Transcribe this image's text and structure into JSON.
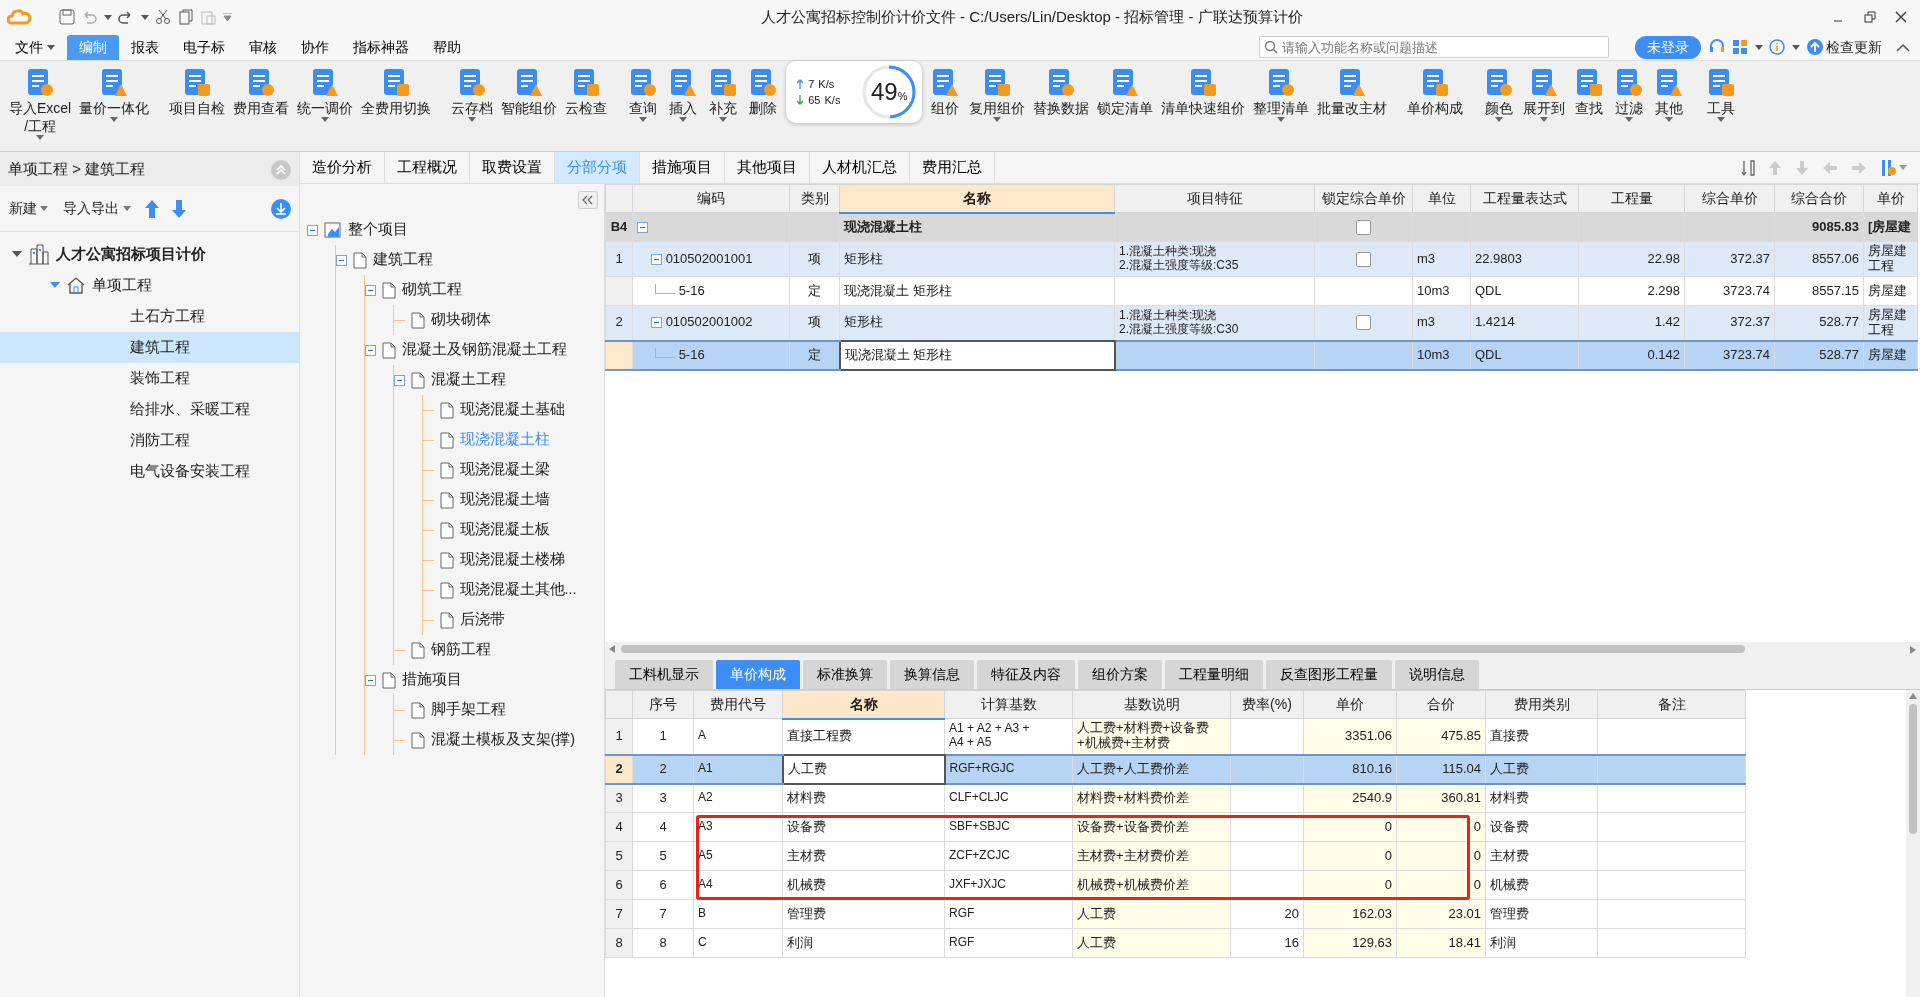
{
  "title_bar": {
    "title": "人才公寓招标控制价计价文件 - C:/Users/Lin/Desktop - 招标管理 - 广联达预算计价"
  },
  "menu": [
    {
      "label": "文件",
      "dropdown": true,
      "selected": false
    },
    {
      "label": "编制",
      "dropdown": false,
      "selected": true
    },
    {
      "label": "报表",
      "dropdown": false,
      "selected": false
    },
    {
      "label": "电子标",
      "dropdown": false,
      "selected": false
    },
    {
      "label": "审核",
      "dropdown": false,
      "selected": false
    },
    {
      "label": "协作",
      "dropdown": false,
      "selected": false
    },
    {
      "label": "指标神器",
      "dropdown": false,
      "selected": false
    },
    {
      "label": "帮助",
      "dropdown": false,
      "selected": false
    }
  ],
  "search": {
    "placeholder": "请输入功能名称或问题描述"
  },
  "login_button": "未登录",
  "update_button": "检查更新",
  "ribbon": {
    "groups": [
      [
        {
          "label": "导入Excel\n/工程",
          "dropdown": true
        },
        {
          "label": "量价一体化",
          "dropdown": true
        }
      ],
      [
        {
          "label": "项目自检",
          "dropdown": false
        },
        {
          "label": "费用查看",
          "dropdown": false
        },
        {
          "label": "统一调价",
          "dropdown": true
        },
        {
          "label": "全费用切换",
          "dropdown": false
        }
      ],
      [
        {
          "label": "云存档",
          "dropdown": true
        },
        {
          "label": "智能组价",
          "dropdown": false
        },
        {
          "label": "云检查",
          "dropdown": false
        }
      ],
      [
        {
          "label": "查询",
          "dropdown": true
        },
        {
          "label": "插入",
          "dropdown": true
        },
        {
          "label": "补充",
          "dropdown": true
        },
        {
          "label": "删除",
          "dropdown": false
        },
        {
          "kind": "widget"
        },
        {
          "label": "组价",
          "dropdown": false
        },
        {
          "label": "复用组价",
          "dropdown": true
        },
        {
          "label": "替换数据",
          "dropdown": false
        },
        {
          "label": "锁定清单",
          "dropdown": false
        },
        {
          "label": "清单快速组价",
          "dropdown": false
        },
        {
          "label": "整理清单",
          "dropdown": true
        },
        {
          "label": "批量改主材",
          "dropdown": false
        }
      ],
      [
        {
          "label": "单价构成",
          "dropdown": false
        }
      ],
      [
        {
          "label": "颜色",
          "dropdown": true
        },
        {
          "label": "展开到",
          "dropdown": true
        },
        {
          "label": "查找",
          "dropdown": false
        },
        {
          "label": "过滤",
          "dropdown": true
        },
        {
          "label": "其他",
          "dropdown": true
        }
      ],
      [
        {
          "label": "工具",
          "dropdown": true
        }
      ]
    ]
  },
  "speed_widget": {
    "upload": "7",
    "upload_unit": "K/s",
    "download": "65",
    "download_unit": "K/s",
    "percent": "49",
    "percent_sign": "%",
    "level": 0.49
  },
  "project_panel": {
    "breadcrumb": "单项工程 > 建筑工程",
    "toolbar": [
      {
        "label": "新建",
        "dropdown": true
      },
      {
        "label": "导入导出",
        "dropdown": true
      }
    ],
    "tree": [
      {
        "label": "人才公寓招标项目计价",
        "expanded": true,
        "selected": false,
        "children": [
          {
            "label": "单项工程",
            "expanded": true,
            "selected": false,
            "children": [
              {
                "label": "土石方工程",
                "selected": false
              },
              {
                "label": "建筑工程",
                "selected": true
              },
              {
                "label": "装饰工程",
                "selected": false
              },
              {
                "label": "给排水、采暖工程",
                "selected": false
              },
              {
                "label": "消防工程",
                "selected": false
              },
              {
                "label": "电气设备安装工程",
                "selected": false
              }
            ]
          }
        ]
      }
    ]
  },
  "view_tabs": [
    {
      "label": "造价分析",
      "selected": false
    },
    {
      "label": "工程概况",
      "selected": false
    },
    {
      "label": "取费设置",
      "selected": false
    },
    {
      "label": "分部分项",
      "selected": true
    },
    {
      "label": "措施项目",
      "selected": false
    },
    {
      "label": "其他项目",
      "selected": false
    },
    {
      "label": "人材机汇总",
      "selected": false
    },
    {
      "label": "费用汇总",
      "selected": false
    }
  ],
  "section_tree": [
    {
      "label": "整个项目",
      "expanded": true,
      "selected": false,
      "children": [
        {
          "label": "建筑工程",
          "expanded": true,
          "selected": false,
          "children": [
            {
              "label": "砌筑工程",
              "expanded": true,
              "selected": false,
              "children": [
                {
                  "label": "砌块砌体",
                  "selected": false
                }
              ]
            },
            {
              "label": "混凝土及钢筋混凝土工程",
              "expanded": true,
              "selected": false,
              "children": [
                {
                  "label": "混凝土工程",
                  "expanded": true,
                  "selected": false,
                  "children": [
                    {
                      "label": "现浇混凝土基础",
                      "selected": false
                    },
                    {
                      "label": "现浇混凝土柱",
                      "selected": true
                    },
                    {
                      "label": "现浇混凝土梁",
                      "selected": false
                    },
                    {
                      "label": "现浇混凝土墙",
                      "selected": false
                    },
                    {
                      "label": "现浇混凝土板",
                      "selected": false
                    },
                    {
                      "label": "现浇混凝土楼梯",
                      "selected": false
                    },
                    {
                      "label": "现浇混凝土其他...",
                      "selected": false
                    },
                    {
                      "label": "后浇带",
                      "selected": false
                    }
                  ]
                },
                {
                  "label": "钢筋工程",
                  "selected": false
                }
              ]
            },
            {
              "label": "措施项目",
              "expanded": true,
              "selected": false,
              "children": [
                {
                  "label": "脚手架工程",
                  "selected": false
                },
                {
                  "label": "混凝土模板及支架(撑)",
                  "selected": false
                }
              ]
            }
          ]
        }
      ]
    }
  ],
  "item_table": {
    "columns": [
      {
        "label": "编码",
        "active": false
      },
      {
        "label": "类别",
        "active": false
      },
      {
        "label": "名称",
        "active": true
      },
      {
        "label": "项目特征",
        "active": false
      },
      {
        "label": "锁定综合单价",
        "active": false
      },
      {
        "label": "单位",
        "active": false
      },
      {
        "label": "工程量表达式",
        "active": false
      },
      {
        "label": "工程量",
        "active": false
      },
      {
        "label": "综合单价",
        "active": false
      },
      {
        "label": "综合合价",
        "active": false
      },
      {
        "label": "单价",
        "active": false
      }
    ],
    "rows": [
      {
        "kind": "section",
        "number": "B4",
        "expanded": true,
        "selected": false,
        "name": "现浇混凝土柱",
        "locked": false,
        "total": "9085.83",
        "column_12": "[房屋建"
      },
      {
        "kind": "item",
        "number": "1",
        "expanded": true,
        "selected": false,
        "code": "010502001001",
        "category": "项",
        "name": "矩形柱",
        "features": "1.混凝土种类:现浇\n2.混凝土强度等级:C35",
        "locked": false,
        "unit": "m3",
        "expression": "22.9803",
        "quantity": "22.98",
        "unit_price": "372.37",
        "total": "8557.06",
        "column_12": "房屋建工程"
      },
      {
        "kind": "quota",
        "selected": false,
        "code": "5-16",
        "category": "定",
        "name": "现浇混凝土 矩形柱",
        "unit": "10m3",
        "expression": "QDL",
        "quantity": "2.298",
        "unit_price": "3723.74",
        "total": "8557.15",
        "column_12": "房屋建"
      },
      {
        "kind": "item",
        "number": "2",
        "expanded": true,
        "selected": false,
        "code": "010502001002",
        "category": "项",
        "name": "矩形柱",
        "features": "1.混凝土种类:现浇\n2.混凝土强度等级:C30",
        "locked": false,
        "unit": "m3",
        "expression": "1.4214",
        "quantity": "1.42",
        "unit_price": "372.37",
        "total": "528.77",
        "column_12": "房屋建工程"
      },
      {
        "kind": "quota",
        "selected": true,
        "code": "5-16",
        "category": "定",
        "name": "现浇混凝土 矩形柱",
        "unit": "10m3",
        "expression": "QDL",
        "quantity": "0.142",
        "unit_price": "3723.74",
        "total": "528.77",
        "column_12": "房屋建"
      }
    ]
  },
  "detail_tabs": [
    {
      "label": "工料机显示",
      "selected": false
    },
    {
      "label": "单价构成",
      "selected": true
    },
    {
      "label": "标准换算",
      "selected": false
    },
    {
      "label": "换算信息",
      "selected": false
    },
    {
      "label": "特征及内容",
      "selected": false
    },
    {
      "label": "组价方案",
      "selected": false
    },
    {
      "label": "工程量明细",
      "selected": false
    },
    {
      "label": "反查图形工程量",
      "selected": false
    },
    {
      "label": "说明信息",
      "selected": false
    }
  ],
  "cost_table": {
    "columns": [
      {
        "label": "序号",
        "active": false
      },
      {
        "label": "费用代号",
        "active": false
      },
      {
        "label": "名称",
        "active": true
      },
      {
        "label": "计算基数",
        "active": false
      },
      {
        "label": "基数说明",
        "active": false
      },
      {
        "label": "费率(%)",
        "active": false
      },
      {
        "label": "单价",
        "active": false
      },
      {
        "label": "合价",
        "active": false
      },
      {
        "label": "费用类别",
        "active": false
      },
      {
        "label": "备注",
        "active": false
      }
    ],
    "rows": [
      {
        "number": "1",
        "seq": "1",
        "code": "A",
        "name": "直接工程费",
        "base": "A1 + A2 + A3 +\nA4 + A5",
        "base_desc": "人工费+材料费+设备费\n+机械费+主材费",
        "unit_price": "3351.06",
        "total": "475.85",
        "category": "直接费",
        "selected": false,
        "boxed": false
      },
      {
        "number": "2",
        "seq": "2",
        "code": "A1",
        "name": "人工费",
        "base": "RGF+RGJC",
        "base_desc": "人工费+人工费价差",
        "unit_price": "810.16",
        "total": "115.04",
        "category": "人工费",
        "selected": true,
        "boxed": false
      },
      {
        "number": "3",
        "seq": "3",
        "code": "A2",
        "name": "材料费",
        "base": "CLF+CLJC",
        "base_desc": "材料费+材料费价差",
        "unit_price": "2540.9",
        "total": "360.81",
        "category": "材料费",
        "selected": false,
        "boxed": false
      },
      {
        "number": "4",
        "seq": "4",
        "code": "A3",
        "name": "设备费",
        "base": "SBF+SBJC",
        "base_desc": "设备费+设备费价差",
        "unit_price": "0",
        "total": "0",
        "category": "设备费",
        "selected": false,
        "boxed": true
      },
      {
        "number": "5",
        "seq": "5",
        "code": "A5",
        "name": "主材费",
        "base": "ZCF+ZCJC",
        "base_desc": "主材费+主材费价差",
        "unit_price": "0",
        "total": "0",
        "category": "主材费",
        "selected": false,
        "boxed": true
      },
      {
        "number": "6",
        "seq": "6",
        "code": "A4",
        "name": "机械费",
        "base": "JXF+JXJC",
        "base_desc": "机械费+机械费价差",
        "unit_price": "0",
        "total": "0",
        "category": "机械费",
        "selected": false,
        "boxed": true
      },
      {
        "number": "7",
        "seq": "7",
        "code": "B",
        "name": "管理费",
        "base": "RGF",
        "base_desc": "人工费",
        "rate": "20",
        "unit_price": "162.03",
        "total": "23.01",
        "category": "管理费",
        "selected": false,
        "boxed": false
      },
      {
        "number": "8",
        "seq": "8",
        "code": "C",
        "name": "利润",
        "base": "RGF",
        "base_desc": "人工费",
        "rate": "16",
        "unit_price": "129.63",
        "total": "18.41",
        "category": "利润",
        "selected": false,
        "boxed": false
      }
    ]
  }
}
